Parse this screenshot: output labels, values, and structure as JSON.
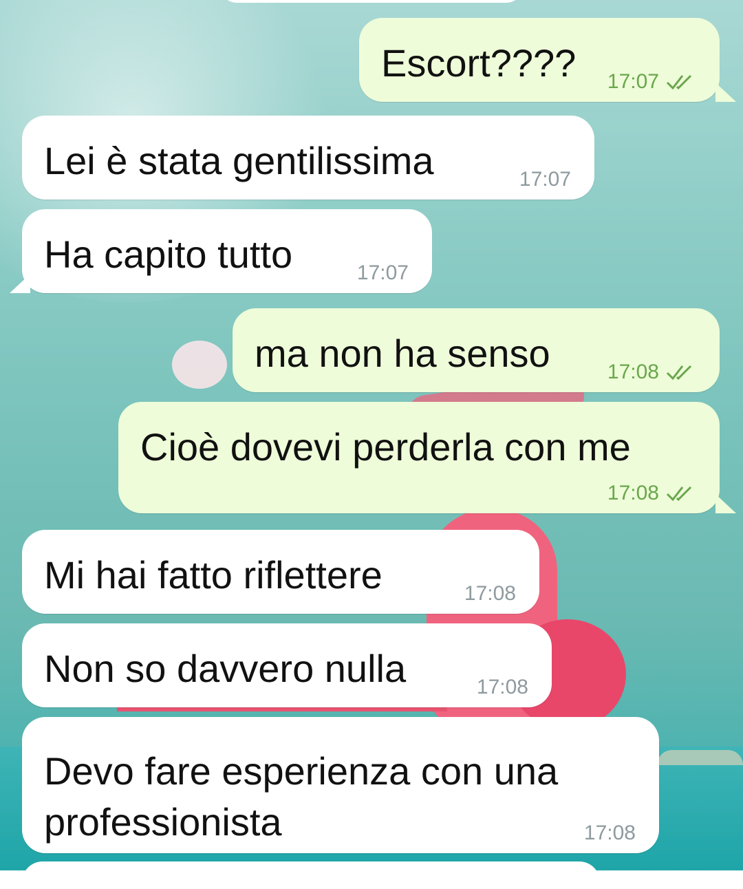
{
  "messages": [
    {
      "direction": "outgoing",
      "text": "Escort????",
      "time": "17:07",
      "status": "read"
    },
    {
      "direction": "incoming",
      "text": "Lei è stata gentilissima",
      "time": "17:07"
    },
    {
      "direction": "incoming",
      "text": "Ha capito tutto",
      "time": "17:07"
    },
    {
      "direction": "outgoing",
      "text": "ma non ha senso",
      "time": "17:08",
      "status": "read"
    },
    {
      "direction": "outgoing",
      "text": "Cioè dovevi perderla con me",
      "time": "17:08",
      "status": "read"
    },
    {
      "direction": "incoming",
      "text": "Mi hai fatto riflettere",
      "time": "17:08"
    },
    {
      "direction": "incoming",
      "text": "Non so davvero nulla",
      "time": "17:08"
    },
    {
      "direction": "incoming",
      "text": "Devo fare esperienza con una professionista",
      "time": "17:08"
    }
  ],
  "icons": {
    "read_receipt": "double-check-icon"
  },
  "colors": {
    "incoming_bubble": "#ffffff",
    "outgoing_bubble": "#eefcd9",
    "read_tick": "#6aa64c",
    "timestamp": "#8e9a9e"
  }
}
